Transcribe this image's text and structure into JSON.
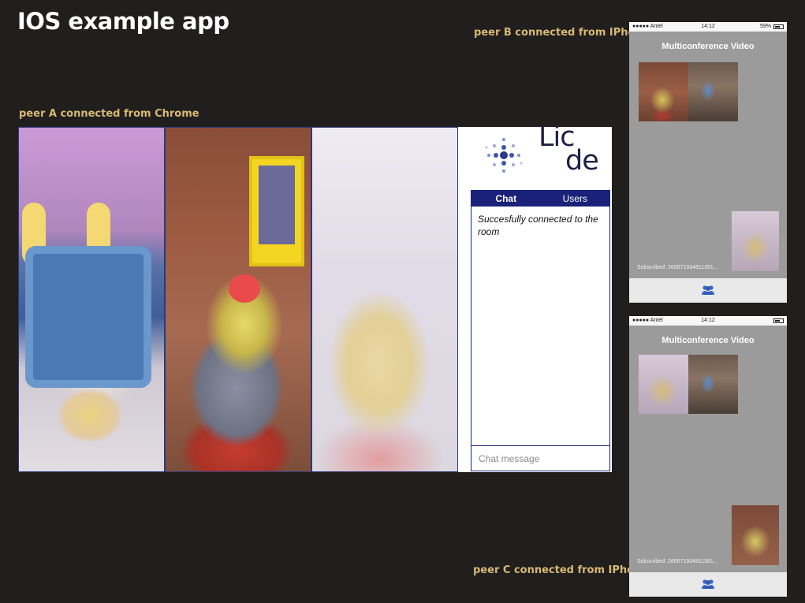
{
  "page": {
    "title": "IOS example app",
    "captions": {
      "peer_a": "peer A connected from Chrome",
      "peer_b": "peer B connected from IPhone",
      "peer_c": "peer C connected from IPhone"
    }
  },
  "chrome_client": {
    "logo": {
      "line1": "Lic",
      "line2": "de",
      "brand": "Licode"
    },
    "chat": {
      "tabs": [
        {
          "label": "Chat",
          "active": true
        },
        {
          "label": "Users",
          "active": false
        }
      ],
      "messages": [
        "Succesfully connected to the room"
      ],
      "input_placeholder": "Chat message"
    },
    "colors": {
      "accent": "#1a2178"
    }
  },
  "phones": [
    {
      "id": "peer-b",
      "status": {
        "carrier": "●●●●● Antel",
        "time": "14:12",
        "right": "59%"
      },
      "title": "Multiconference Video",
      "subscribed": "Subscribed: 260671934811391...",
      "tab_icon": "people-icon"
    },
    {
      "id": "peer-c",
      "status": {
        "carrier": "●●●●● Antel",
        "time": "14:12",
        "right": ""
      },
      "title": "Multiconference Video",
      "subscribed": "Subscribed: 260671934811391...",
      "tab_icon": "people-icon"
    }
  ]
}
